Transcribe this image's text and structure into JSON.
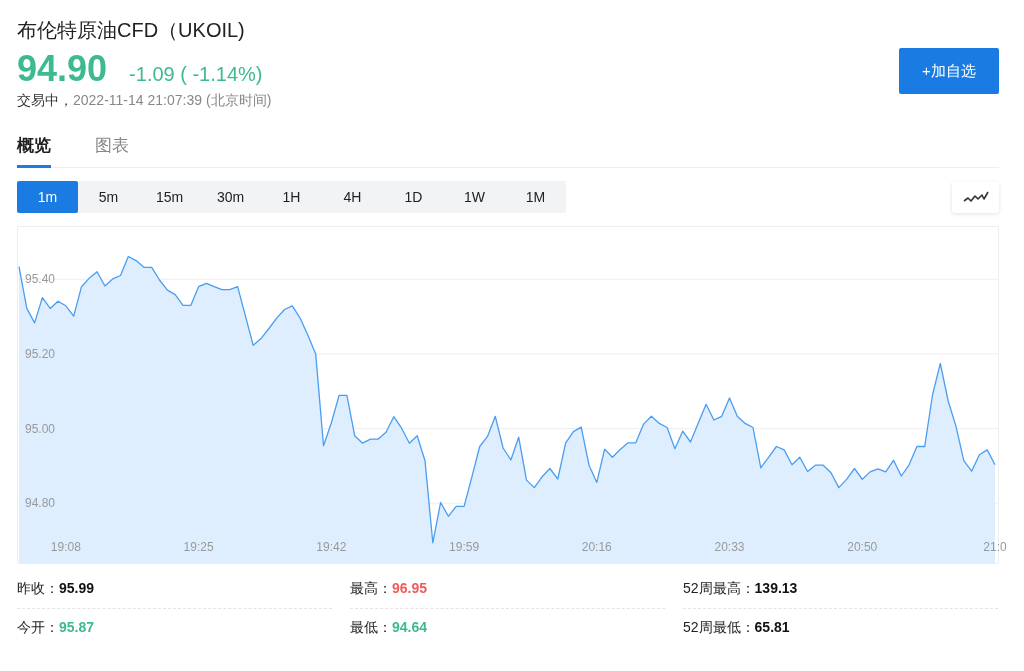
{
  "header": {
    "title": "布伦特原油CFD（UKOIL)",
    "price": "94.90",
    "change": "-1.09 ( -1.14%)",
    "status": "交易中，",
    "time": "2022-11-14 21:07:39",
    "timezone": "(北京时间)",
    "watch_button": "+加自选"
  },
  "line_chart_toggle": {
    "selected": true
  },
  "tabs": [
    {
      "label": "概览",
      "selected": true
    },
    {
      "label": "图表",
      "selected": false
    }
  ],
  "timeframes": [
    {
      "label": "1m",
      "selected": true
    },
    {
      "label": "5m",
      "selected": false
    },
    {
      "label": "15m",
      "selected": false
    },
    {
      "label": "30m",
      "selected": false
    },
    {
      "label": "1H",
      "selected": false
    },
    {
      "label": "4H",
      "selected": false
    },
    {
      "label": "1D",
      "selected": false
    },
    {
      "label": "1W",
      "selected": false
    },
    {
      "label": "1M",
      "selected": false
    }
  ],
  "chart_data": {
    "type": "area",
    "grid": true,
    "ylim": [
      94.64,
      95.54
    ],
    "categories": [
      null,
      null,
      null,
      null,
      null,
      null,
      "19:08",
      null,
      null,
      null,
      null,
      null,
      null,
      null,
      null,
      null,
      null,
      null,
      null,
      null,
      null,
      null,
      null,
      "19:25",
      null,
      null,
      null,
      null,
      null,
      null,
      null,
      null,
      null,
      null,
      null,
      null,
      null,
      null,
      null,
      null,
      "19:42",
      null,
      null,
      null,
      null,
      null,
      null,
      null,
      null,
      null,
      null,
      null,
      null,
      null,
      null,
      null,
      null,
      "19:59",
      null,
      null,
      null,
      null,
      null,
      null,
      null,
      null,
      null,
      null,
      null,
      null,
      null,
      null,
      null,
      null,
      "20:16",
      null,
      null,
      null,
      null,
      null,
      null,
      null,
      null,
      null,
      null,
      null,
      null,
      null,
      null,
      null,
      null,
      "20:33",
      null,
      null,
      null,
      null,
      null,
      null,
      null,
      null,
      null,
      null,
      null,
      null,
      null,
      null,
      null,
      null,
      "20:50",
      null,
      null,
      null,
      null,
      null,
      null,
      null,
      null,
      null,
      null,
      null,
      null,
      null,
      null,
      null,
      null,
      "21:0"
    ],
    "yticks": [
      {
        "value": 94.8,
        "label": "94.80"
      },
      {
        "value": 95.0,
        "label": "95.00"
      },
      {
        "value": 95.2,
        "label": "95.20"
      },
      {
        "value": 95.4,
        "label": "95.40"
      }
    ],
    "series": [
      {
        "color": "#4a9df0",
        "values": [
          95.434,
          95.322,
          95.283,
          95.351,
          95.322,
          95.341,
          95.329,
          95.301,
          95.38,
          95.403,
          95.42,
          95.382,
          95.401,
          95.41,
          95.461,
          95.45,
          95.432,
          95.432,
          95.398,
          95.371,
          95.359,
          95.33,
          95.33,
          95.38,
          95.389,
          95.38,
          95.372,
          95.372,
          95.38,
          95.302,
          95.223,
          95.241,
          95.268,
          95.296,
          95.319,
          95.329,
          95.296,
          95.25,
          95.2,
          94.954,
          95.015,
          95.089,
          95.089,
          94.981,
          94.961,
          94.972,
          94.972,
          94.99,
          95.032,
          95.001,
          94.961,
          94.981,
          94.914,
          94.694,
          94.802,
          94.765,
          94.792,
          94.792,
          94.871,
          94.952,
          94.979,
          95.033,
          94.948,
          94.916,
          94.977,
          94.862,
          94.842,
          94.871,
          94.893,
          94.865,
          94.961,
          94.992,
          95.004,
          94.902,
          94.856,
          94.945,
          94.923,
          94.944,
          94.962,
          94.962,
          95.012,
          95.033,
          95.014,
          95.003,
          94.946,
          94.993,
          94.964,
          95.015,
          95.065,
          95.023,
          95.033,
          95.082,
          95.033,
          95.014,
          95.003,
          94.895,
          94.923,
          94.952,
          94.943,
          94.903,
          94.923,
          94.885,
          94.902,
          94.902,
          94.882,
          94.842,
          94.864,
          94.893,
          94.864,
          94.884,
          94.892,
          94.884,
          94.915,
          94.873,
          94.903,
          94.952,
          94.952,
          95.09,
          95.175,
          95.074,
          95.006,
          94.914,
          94.886,
          94.93,
          94.943,
          94.903
        ]
      }
    ]
  },
  "stats": [
    {
      "label": "昨收：",
      "value": "95.99",
      "color": "#111111"
    },
    {
      "label": "最高：",
      "value": "96.95",
      "color": "#f25a5a"
    },
    {
      "label": "52周最高：",
      "value": "139.13",
      "color": "#111111"
    },
    {
      "label": "今开：",
      "value": "95.87",
      "color": "#3dbb8e"
    },
    {
      "label": "最低：",
      "value": "94.64",
      "color": "#3dbb8e"
    },
    {
      "label": "52周最低：",
      "value": "65.81",
      "color": "#111111"
    }
  ]
}
